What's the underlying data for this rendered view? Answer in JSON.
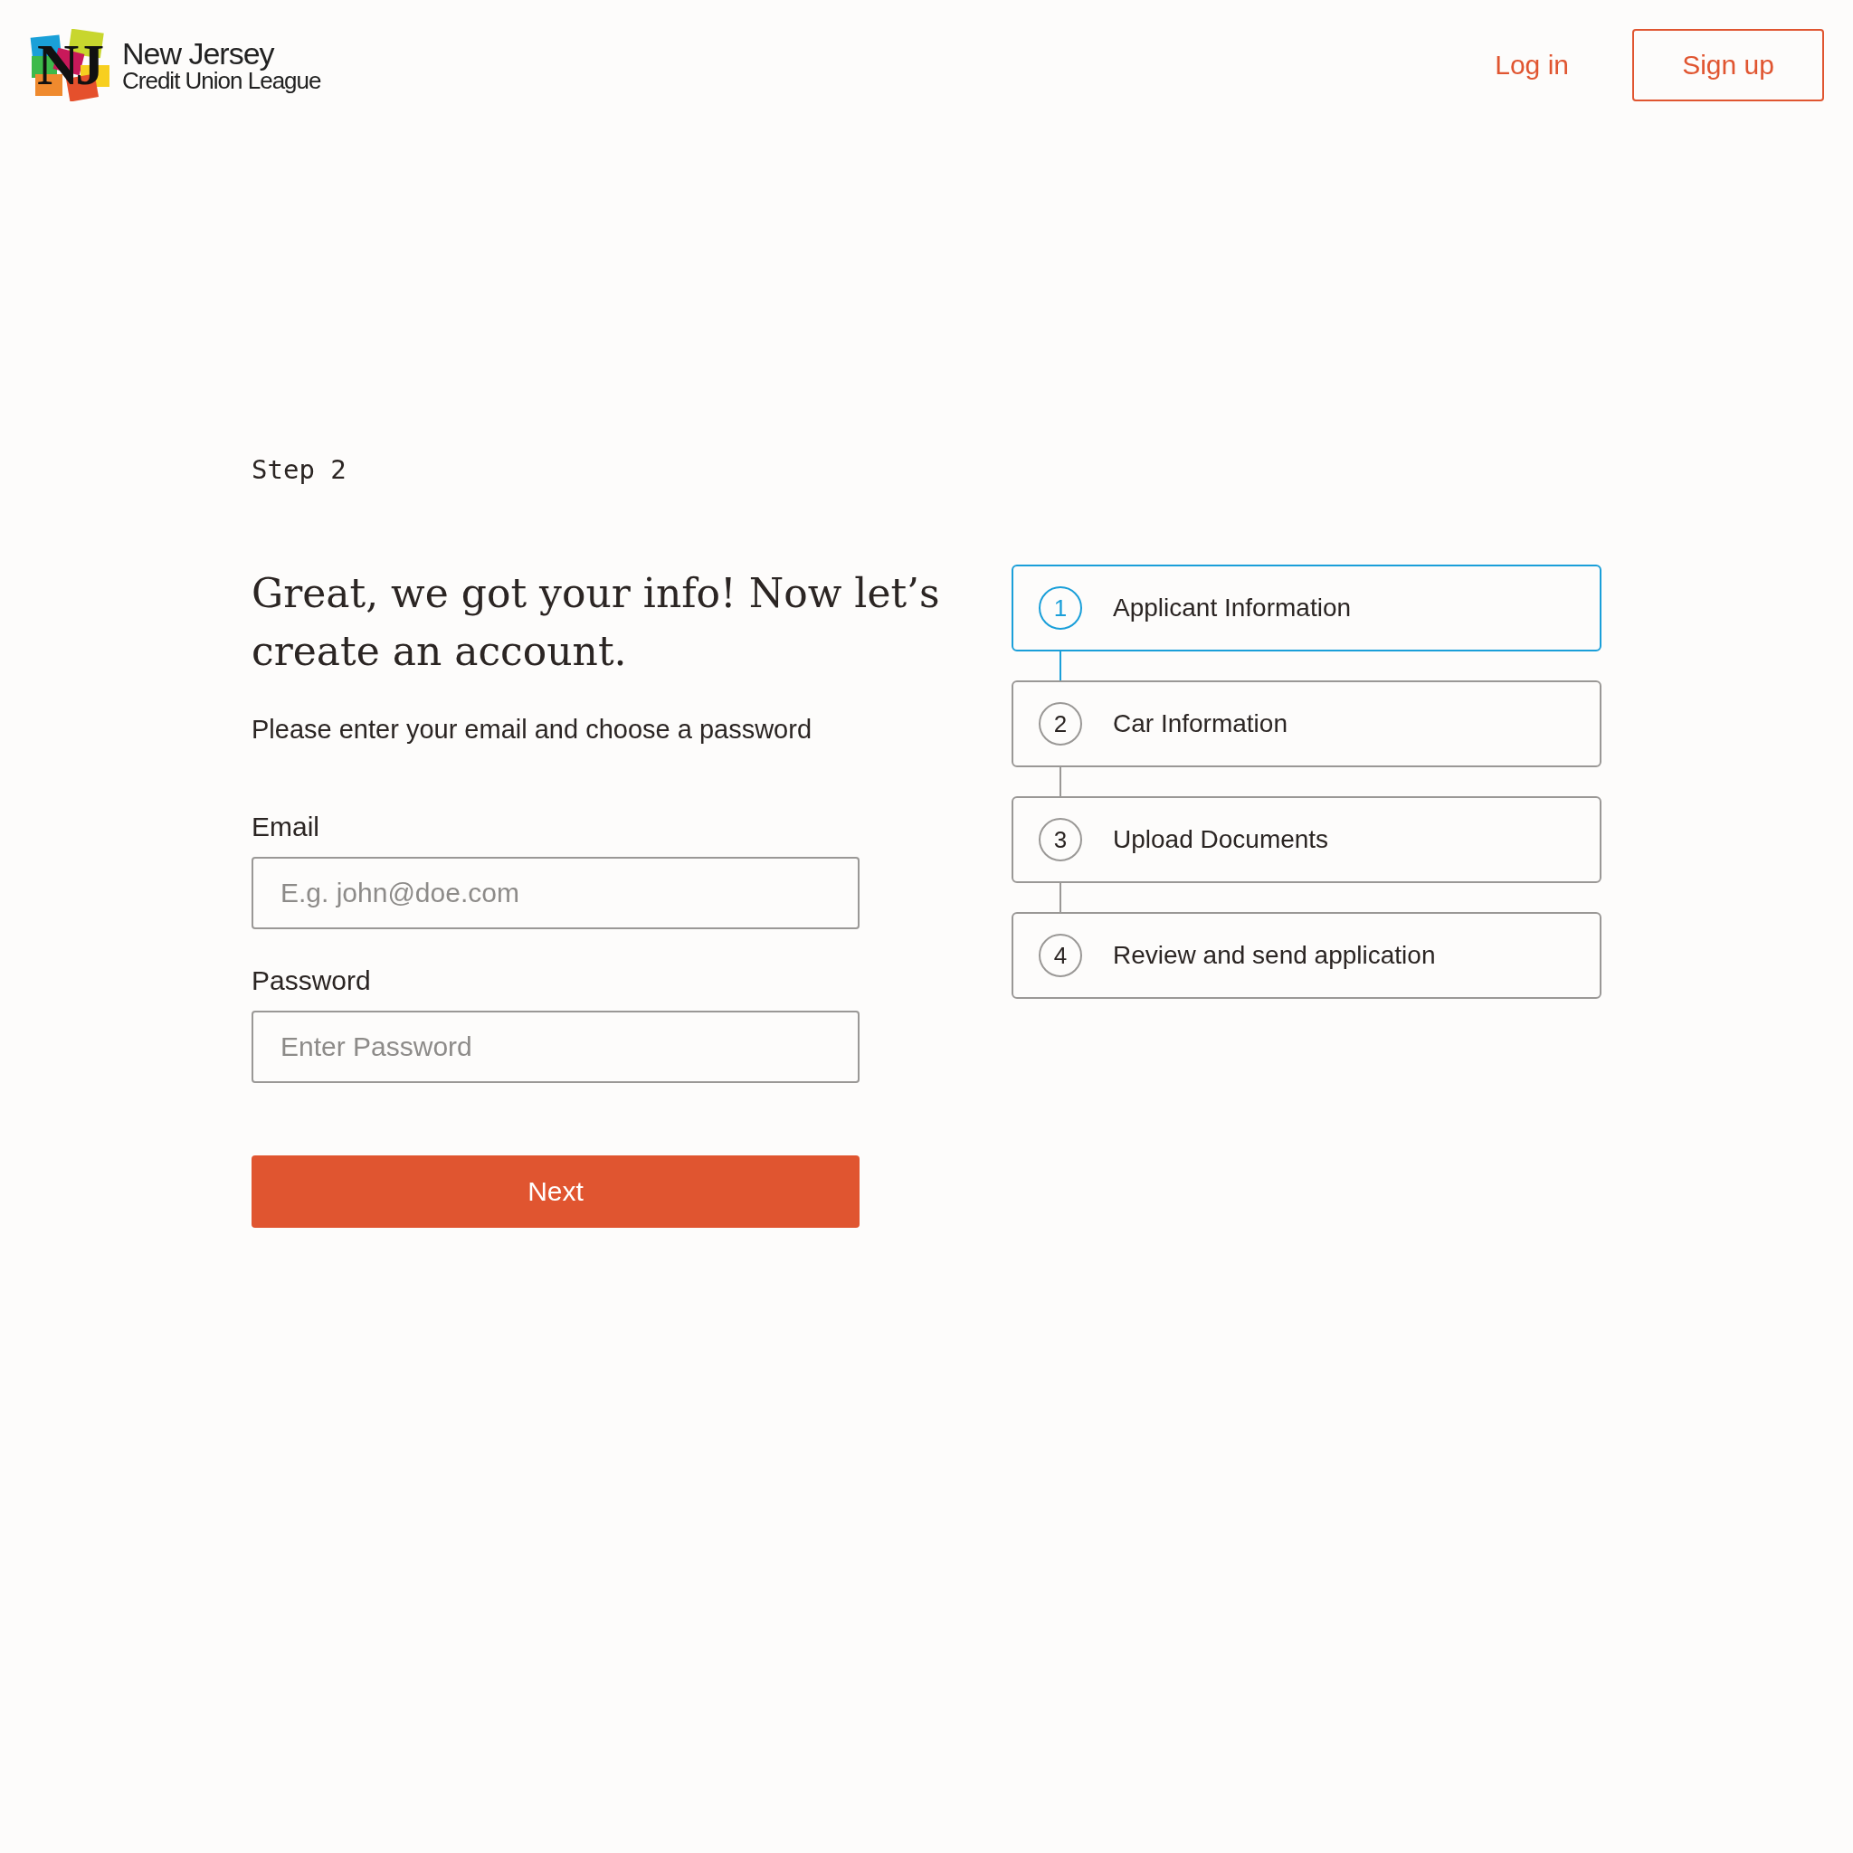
{
  "header": {
    "logo": {
      "mark": "NJ",
      "line_1": "New Jersey",
      "line_2": "Credit Union League"
    },
    "login": "Log in",
    "signup": "Sign up"
  },
  "step_label": "Step 2",
  "heading": "Great, we got your info! Now let’s create an account.",
  "subtitle": "Please enter your email and choose a password",
  "fields": [
    {
      "label": "Email",
      "placeholder": "E.g. john@doe.com"
    },
    {
      "label": "Password",
      "placeholder": "Enter Password"
    }
  ],
  "next_button": "Next",
  "steps": [
    {
      "number": "1",
      "label": "Applicant Information",
      "selected": true
    },
    {
      "number": "2",
      "label": "Car Information",
      "selected": false
    },
    {
      "number": "3",
      "label": "Upload Documents",
      "selected": false
    },
    {
      "number": "4",
      "label": "Review and send application",
      "selected": false
    }
  ]
}
